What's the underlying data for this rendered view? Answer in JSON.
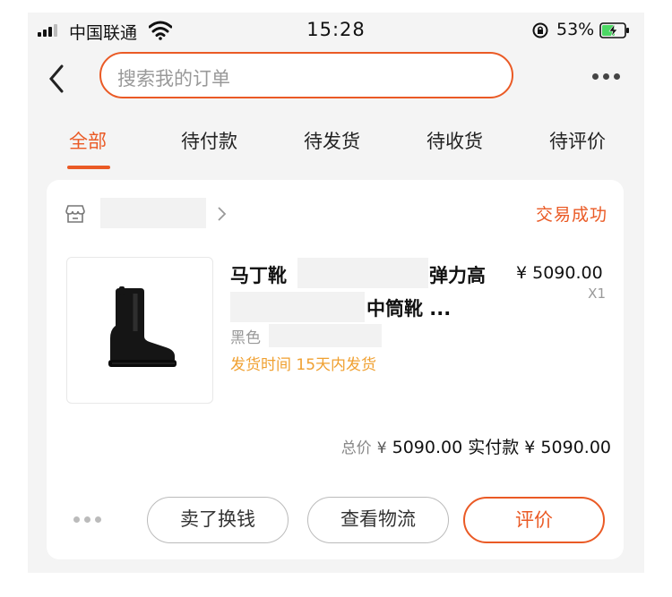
{
  "status_bar": {
    "carrier": "中国联通",
    "time": "15:28",
    "battery_percent": "53%",
    "icons": [
      "signal-icon",
      "wifi-icon",
      "rotation-lock-icon",
      "battery-charging-icon"
    ]
  },
  "nav": {
    "back_icon": "chevron-left-icon",
    "search_placeholder": "搜索我的订单",
    "more_icon": "more-dots-icon"
  },
  "tabs": [
    {
      "label": "全部",
      "active": true
    },
    {
      "label": "待付款",
      "active": false
    },
    {
      "label": "待发货",
      "active": false
    },
    {
      "label": "待收货",
      "active": false
    },
    {
      "label": "待评价",
      "active": false
    }
  ],
  "order": {
    "shop_icon": "store-icon",
    "status": "交易成功",
    "product": {
      "title_part1": "马丁靴",
      "title_part2": "弹力高",
      "title_part3": "中筒靴 ...",
      "variant": "黑色",
      "shipping_note": "发货时间 15天内发货",
      "price": "¥ 5090.00",
      "quantity": "X1"
    },
    "totals": {
      "total_label": "总价",
      "total_currency": "¥",
      "total_value": "5090.00",
      "paid_label": "实付款",
      "paid_value": "¥ 5090.00"
    },
    "actions": {
      "sell_label": "卖了换钱",
      "logistics_label": "查看物流",
      "review_label": "评价"
    }
  },
  "colors": {
    "accent": "#ea5a25",
    "shipping_text": "#f0a030",
    "screen_bg": "#f4f4f4"
  }
}
